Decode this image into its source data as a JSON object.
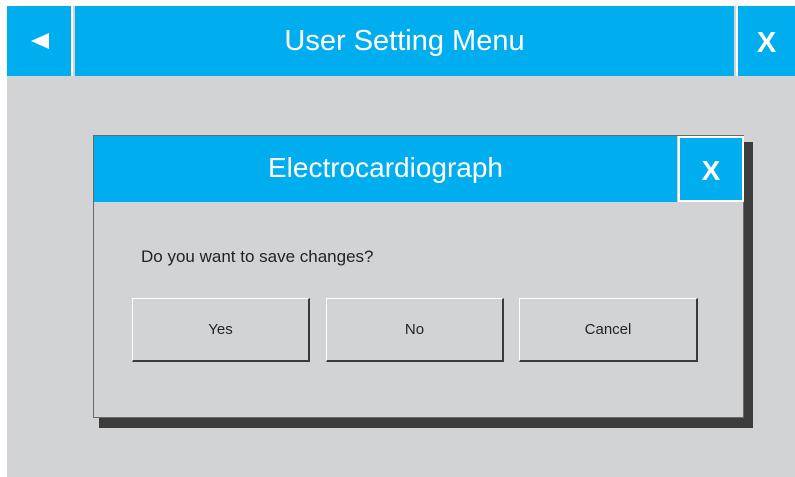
{
  "app": {
    "title": "User Setting Menu",
    "back_icon": "left-triangle-icon",
    "close_label": "X",
    "colors": {
      "accent": "#00adef",
      "background": "#d2d3d5",
      "text_on_accent": "#ffffff"
    }
  },
  "dialog": {
    "title": "Electrocardiograph",
    "close_label": "X",
    "message": "Do you want to save changes?",
    "buttons": {
      "yes": "Yes",
      "no": "No",
      "cancel": "Cancel"
    }
  }
}
